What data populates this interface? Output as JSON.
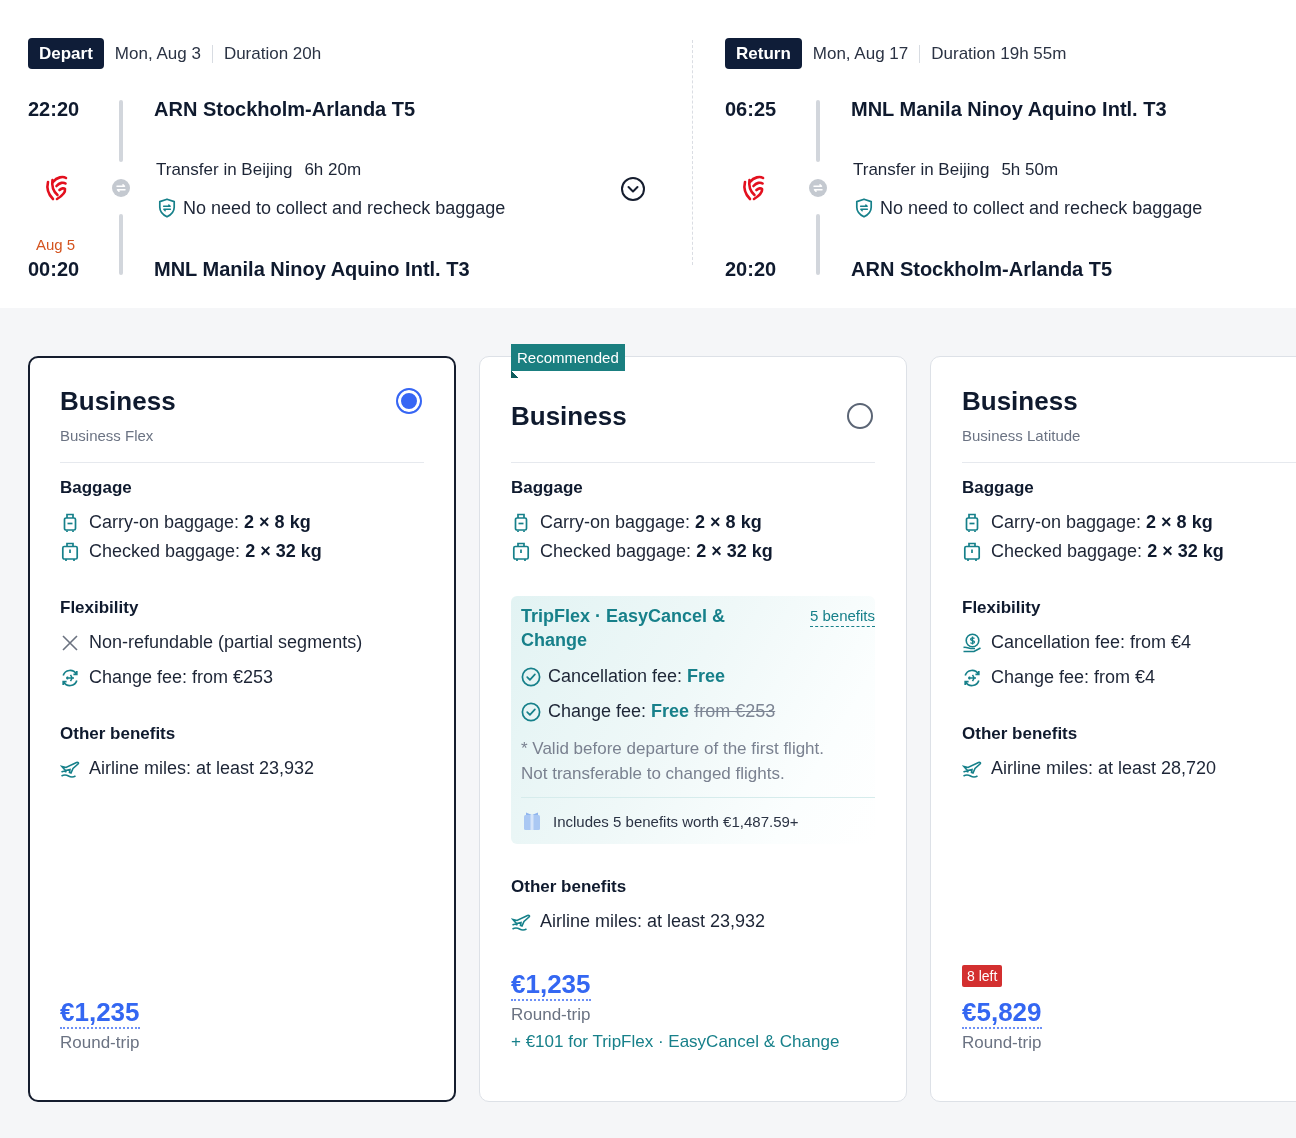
{
  "itinerary": [
    {
      "label": "Depart",
      "date": "Mon, Aug 3",
      "duration": "Duration 20h",
      "expandable": true,
      "departure": {
        "time": "22:20",
        "airport": "ARN Stockholm-Arlanda T5"
      },
      "transfer": {
        "place": "Transfer in Beijing",
        "layover": "6h 20m",
        "note": "No need to collect and recheck baggage"
      },
      "arrival": {
        "date_note": "Aug 5",
        "time": "00:20",
        "airport": "MNL Manila Ninoy Aquino Intl. T3"
      }
    },
    {
      "label": "Return",
      "date": "Mon, Aug 17",
      "duration": "Duration 19h 55m",
      "expandable": false,
      "departure": {
        "time": "06:25",
        "airport": "MNL Manila Ninoy Aquino Intl. T3"
      },
      "transfer": {
        "place": "Transfer in Beijing",
        "layover": "5h 50m",
        "note": "No need to collect and recheck baggage"
      },
      "arrival": {
        "time": "20:20",
        "airport": "ARN Stockholm-Arlanda T5"
      }
    }
  ],
  "fares": [
    {
      "selected": true,
      "title": "Business",
      "subtitle": "Business Flex",
      "sections": [
        {
          "kind": "baggage",
          "heading": "Baggage",
          "items": [
            {
              "kind": "carry-on",
              "text": "Carry-on baggage: **2 × 8 kg**"
            },
            {
              "kind": "checked",
              "text": "Checked baggage: **2 × 32 kg**"
            }
          ]
        },
        {
          "kind": "features",
          "heading": "Flexibility",
          "items": [
            {
              "kind": "cross",
              "text": "Non-refundable (partial segments)"
            },
            {
              "kind": "change",
              "text": "Change fee: from €253"
            }
          ]
        },
        {
          "kind": "features",
          "heading": "Other benefits",
          "items": [
            {
              "kind": "miles",
              "text": "Airline miles: at least 23,932"
            }
          ]
        }
      ],
      "price": "€1,235",
      "price_note": "Round-trip"
    },
    {
      "selected": false,
      "ribbon": "Recommended",
      "title": "Business",
      "sections": [
        {
          "kind": "baggage",
          "heading": "Baggage",
          "items": [
            {
              "kind": "carry-on",
              "text": "Carry-on baggage: **2 × 8 kg**"
            },
            {
              "kind": "checked",
              "text": "Checked baggage: **2 × 32 kg**"
            }
          ]
        },
        {
          "kind": "tripflex",
          "title": "TripFlex · EasyCancel & Change",
          "link": "5 benefits",
          "items": [
            {
              "text": "Cancellation fee:",
              "value": "Free"
            },
            {
              "text": "Change fee:",
              "value": "Free",
              "was": "from €253"
            }
          ],
          "note": "* Valid before departure of the first flight. Not transferable to changed flights.",
          "footer": "Includes 5 benefits worth €1,487.59+"
        },
        {
          "kind": "features",
          "heading": "Other benefits",
          "items": [
            {
              "kind": "miles",
              "text": "Airline miles: at least 23,932"
            }
          ]
        }
      ],
      "price": "€1,235",
      "price_note": "Round-trip",
      "upsell": "+ €101 for TripFlex · EasyCancel & Change"
    },
    {
      "selected": false,
      "title": "Business",
      "subtitle": "Business Latitude",
      "sections": [
        {
          "kind": "baggage",
          "heading": "Baggage",
          "items": [
            {
              "kind": "carry-on",
              "text": "Carry-on baggage: **2 × 8 kg**"
            },
            {
              "kind": "checked",
              "text": "Checked baggage: **2 × 32 kg**"
            }
          ]
        },
        {
          "kind": "features",
          "heading": "Flexibility",
          "items": [
            {
              "kind": "coin",
              "text": "Cancellation fee: from €4"
            },
            {
              "kind": "change",
              "text": "Change fee: from €4"
            }
          ]
        },
        {
          "kind": "features",
          "heading": "Other benefits",
          "items": [
            {
              "kind": "miles",
              "text": "Airline miles: at least 28,720"
            }
          ]
        }
      ],
      "stock_badge": "8 left",
      "price": "€5,829",
      "price_note": "Round-trip"
    }
  ]
}
